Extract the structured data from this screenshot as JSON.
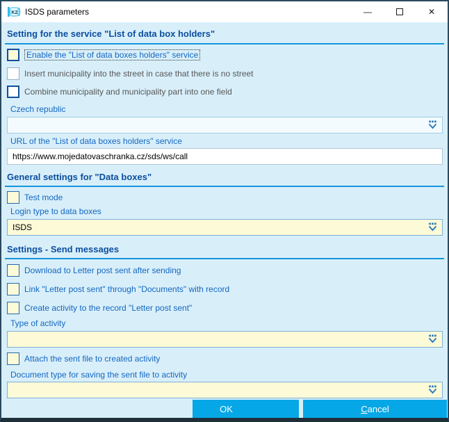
{
  "window": {
    "title": "ISDS parameters",
    "controls": {
      "minimize": "—",
      "close": "✕"
    }
  },
  "icons": {
    "app": "k2-logo-icon",
    "dropdown": "k2-dropdown-chevron-with-dots",
    "maximize": "empty-square-outline"
  },
  "colors": {
    "body_background": "#D8EFFA",
    "section_header_text": "#0C4E9E",
    "section_rule": "#1695DC",
    "label_blue": "#1466C0",
    "label_disabled_gray": "#575757",
    "field_cream": "#FCFAD7",
    "checkbox_focus_border": "#11509B",
    "button_blue": "#06A7E6",
    "dropdown_glyph_blue": "#2B7CC0"
  },
  "section_service": {
    "title": "Setting for the service \"List of data box holders\"",
    "checkbox_enable_label": "Enable the \"List of data boxes holders\" service",
    "checkbox_insert_label": "Insert municipality into the street in case that there is no street",
    "checkbox_combine_label": "Combine municipality and municipality part into one field",
    "country_label": "Czech republic",
    "country_value": "",
    "url_label": "URL of the \"List of data boxes holders\" service",
    "url_value": "https://www.mojedatovaschranka.cz/sds/ws/call"
  },
  "section_general": {
    "title": "General settings for \"Data boxes\"",
    "checkbox_test_mode_label": "Test mode",
    "login_type_label": "Login type to data boxes",
    "login_type_value": "ISDS"
  },
  "section_send": {
    "title": "Settings - Send messages",
    "checkbox_download_label": "Download to Letter post sent after sending",
    "checkbox_link_label": "Link \"Letter post sent\" through \"Documents\" with record",
    "checkbox_create_activity_label": "Create activity to the record \"Letter post sent\"",
    "type_of_activity_label": "Type of activity",
    "type_of_activity_value": "",
    "checkbox_attach_label": "Attach the sent file to created activity",
    "document_type_label": "Document type for saving the sent file to activity",
    "document_type_value": ""
  },
  "footer": {
    "ok_label": "OK",
    "cancel_accel": "C",
    "cancel_rest": "ancel"
  }
}
